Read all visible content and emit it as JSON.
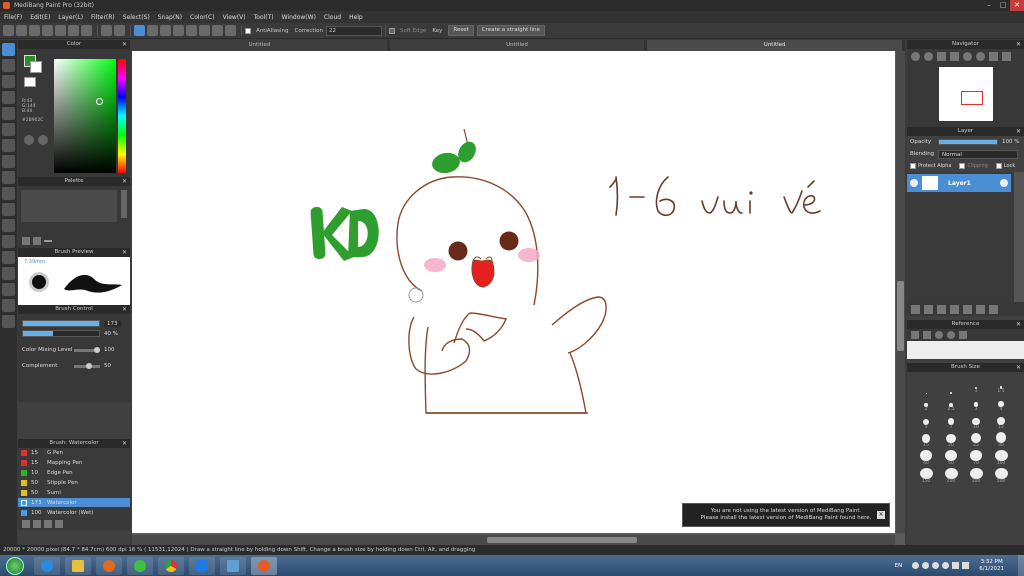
{
  "window": {
    "title": "MediBang Paint Pro (32bit)"
  },
  "menu": [
    "File(F)",
    "Edit(E)",
    "Layer(L)",
    "Filter(R)",
    "Select(S)",
    "Snap(N)",
    "Color(C)",
    "View(V)",
    "Tool(T)",
    "Window(W)",
    "Cloud",
    "Help"
  ],
  "toolbar": {
    "antialiasing": "AntiAliasing",
    "correction_label": "Correction",
    "correction_value": "22",
    "soft_edge": "Soft Edge",
    "key": "Key",
    "reset": "Reset",
    "straight_line": "Create a straight line"
  },
  "tabs": [
    "Untitled",
    "Untitled",
    "Untitled"
  ],
  "panels": {
    "color": "Color",
    "palette": "Palette",
    "brush_preview": "Brush Preview",
    "brush_size_preview": "7.39mm",
    "brush_control": "Brush Control",
    "size_value": "173",
    "opacity_value": "40 %",
    "color_mixing_label": "Color Mixing Level",
    "color_mixing_value": "100",
    "complement_label": "Complement",
    "complement_value": "50",
    "brush_list_title": "Brush: Watercolor",
    "color_readout": {
      "r": "R:43",
      "g": "G:144",
      "b": "B:44",
      "hex": "#2B902C"
    }
  },
  "brushes": [
    {
      "size": "15",
      "name": "G Pen",
      "color": "#e03030"
    },
    {
      "size": "15",
      "name": "Mapping Pen",
      "color": "#e03030"
    },
    {
      "size": "10",
      "name": "Edge Pen",
      "color": "#30b030"
    },
    {
      "size": "50",
      "name": "Stipple Pen",
      "color": "#e0c020"
    },
    {
      "size": "50",
      "name": "Sumi",
      "color": "#e0c020"
    },
    {
      "size": "173",
      "name": "Watercolor",
      "color": "#40a0e0"
    },
    {
      "size": "100",
      "name": "Watercolor (Wet)",
      "color": "#40a0e0"
    }
  ],
  "right": {
    "navigator": "Navigator",
    "layer": "Layer",
    "opacity_label": "Opacity",
    "opacity_value": "100 %",
    "blending_label": "Blending",
    "blending_value": "Normal",
    "protect_alpha": "Protect Alpha",
    "clipping": "Clipping",
    "lock": "Lock",
    "layer_name": "Layer1",
    "reference": "Reference",
    "brush_size": "Brush Size"
  },
  "brush_sizes": [
    "",
    "",
    "1",
    "1.5",
    "2",
    "2.5",
    "3",
    "4",
    "5",
    "7",
    "10",
    "12",
    "15",
    "20",
    "25",
    "30",
    "40",
    "50",
    "70",
    "100",
    "150",
    "200",
    "300",
    "500"
  ],
  "canvas_text": {
    "kd": "KD",
    "note": "1-6 vui vẻ"
  },
  "notice": {
    "line1": "You are not using the latest version of MediBang Paint.",
    "line2": "Please install the latest version of MediBang Paint found here."
  },
  "status": "20000 * 20000 pixel   (84.7 * 84.7cm)   600 dpi   16 %   ( 11531,12024 )   Draw a straight line by holding down Shift, Change a brush size by holding down Ctrl, Alt, and dragging",
  "taskbar": {
    "lang": "EN",
    "time": "3:32 PM",
    "date": "6/1/2021"
  },
  "colors": {
    "green": "#2e9e2e",
    "brown": "#8a4a2a",
    "accent": "#4a8fd4"
  }
}
